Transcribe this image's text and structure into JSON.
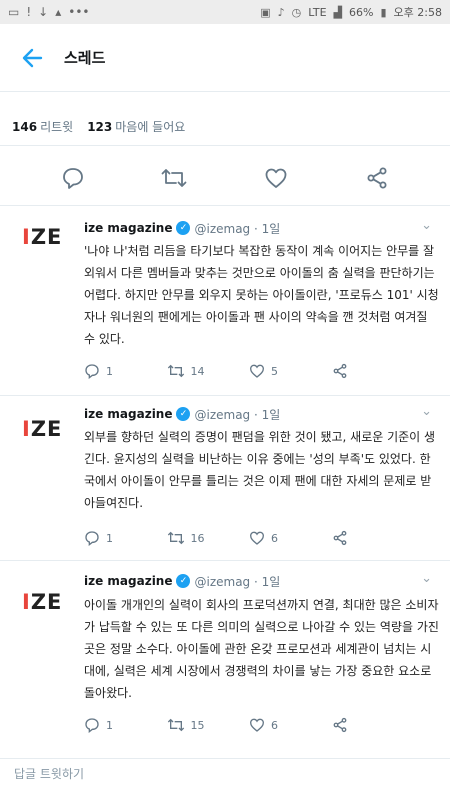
{
  "status_bar": {
    "battery": "66%",
    "network": "LTE",
    "time": "오후 2:58",
    "left_icons": [
      "message-icon",
      "alert-icon",
      "download-icon",
      "notification-icon"
    ],
    "right_icons": [
      "nfc-icon",
      "mute-icon",
      "alarm-icon",
      "wifi-icon",
      "signal-icon"
    ]
  },
  "app_bar": {
    "title": "스레드",
    "back_icon": "back-arrow-icon"
  },
  "stats": {
    "retweets_count": "146",
    "retweets_label": "리트윗",
    "likes_count": "123",
    "likes_label": "마음에 들어요"
  },
  "main_actions": [
    "reply-icon",
    "retweet-icon",
    "like-icon",
    "share-icon"
  ],
  "tweets": [
    {
      "logo": "IZE",
      "name": "ize magazine",
      "handle": "@izemag · 1일",
      "text": "'나야 나'처럼 리듬을 타기보다 복잡한 동작이 계속 이어지는 안무를 잘 외워서 다른 멤버들과 맞추는 것만으로 아이돌의 춤 실력을 판단하기는 어렵다. 하지만 안무를 외우지 못하는 아이돌이란, '프로듀스 101' 시청자나 워너원의 팬에게는 아이돌과 팬 사이의 약속을 깬 것처럼 여겨질 수 있다.",
      "replies": "1",
      "retweets": "14",
      "likes": "5"
    },
    {
      "logo": "IZE",
      "name": "ize magazine",
      "handle": "@izemag · 1일",
      "text": "외부를 향하던 실력의 증명이 팬덤을 위한 것이 됐고, 새로운 기준이 생긴다. 윤지성의 실력을 비난하는 이유 중에는 '성의 부족'도 있었다. 한국에서 아이돌이 안무를 틀리는 것은 이제 팬에 대한 자세의 문제로 받아들여진다.",
      "replies": "1",
      "retweets": "16",
      "likes": "6"
    },
    {
      "logo": "IZE",
      "name": "ize magazine",
      "handle": "@izemag · 1일",
      "text": "아이돌 개개인의 실력이 회사의 프로덕션까지 연결, 최대한 많은 소비자가 납득할 수 있는 또 다른 의미의 실력으로 나아갈 수 있는 역량을 가진 곳은 정말 소수다. 아이돌에 관한 온갖 프로모션과 세계관이 넘치는 시대에, 실력은 세계 시장에서 경쟁력의 차이를 낳는 가장 중요한 요소로 돌아왔다.",
      "replies": "1",
      "retweets": "15",
      "likes": "6"
    }
  ],
  "reply_bar": {
    "placeholder": "답글 트윗하기"
  },
  "colors": {
    "accent": "#1da1f2",
    "muted": "#657786",
    "logo_accent": "#e8453c",
    "divider": "#e6ecf0"
  }
}
